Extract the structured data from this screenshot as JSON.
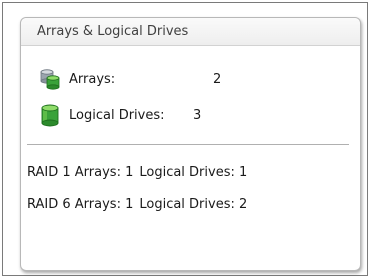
{
  "panel": {
    "title": "Arrays & Logical Drives",
    "summary": [
      {
        "label": "Arrays:",
        "value": "2",
        "icon": "arrays-icon"
      },
      {
        "label": "Logical Drives:",
        "value": "3",
        "icon": "logical-drive-icon"
      }
    ],
    "raid_rows": [
      {
        "arrays_label": "RAID 1 Arrays: 1",
        "drives_label": "Logical Drives: 1"
      },
      {
        "arrays_label": "RAID 6 Arrays: 1",
        "drives_label": "Logical Drives: 2"
      }
    ]
  },
  "colors": {
    "drive_green": "#3aa23a",
    "drive_dark": "#1e6f1e",
    "drive_light": "#8fdc6a",
    "drive_gray": "#9aa4ad"
  }
}
